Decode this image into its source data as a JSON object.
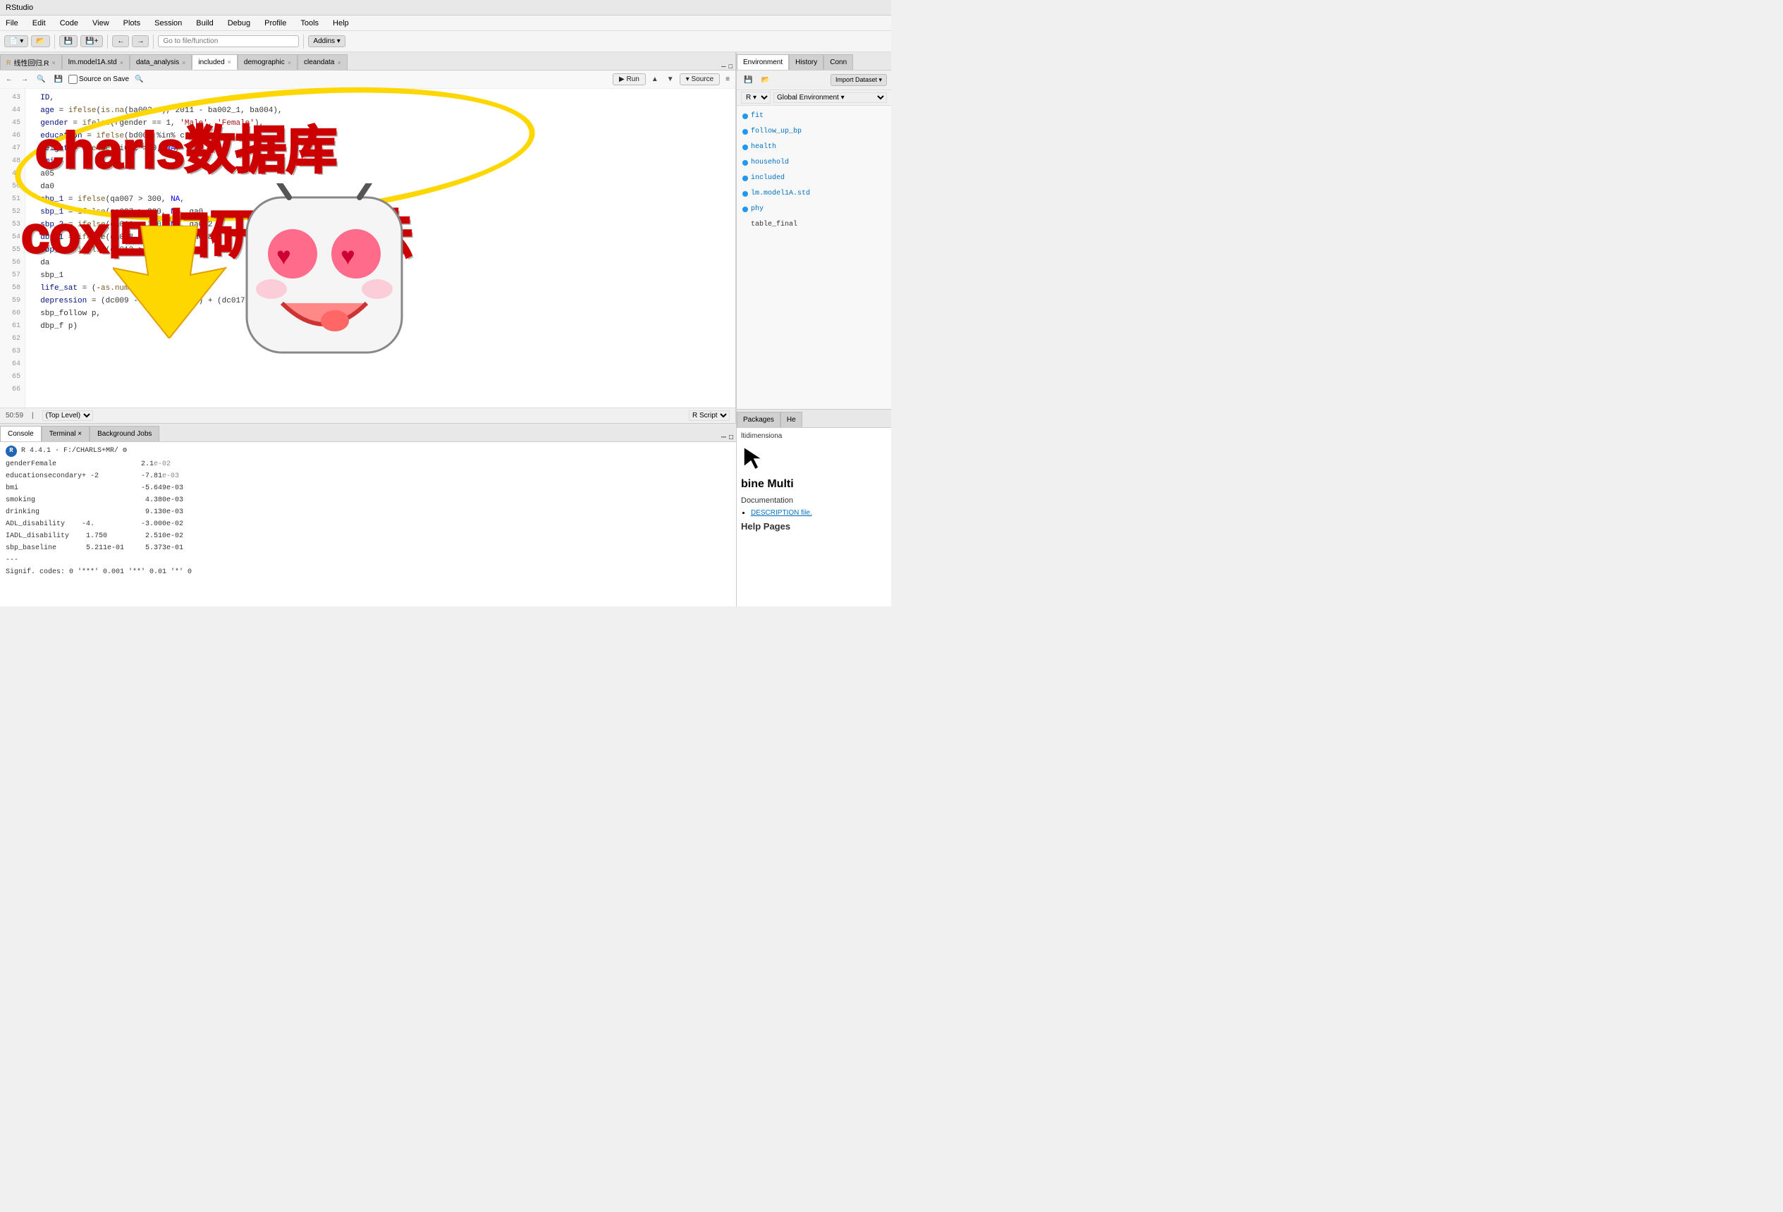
{
  "app": {
    "title": "RStudio",
    "menu_items": [
      "File",
      "Edit",
      "Code",
      "View",
      "Plots",
      "Session",
      "Build",
      "Debug",
      "Profile",
      "Tools",
      "Help"
    ]
  },
  "toolbar": {
    "goto_label": "Go to file/function",
    "addins_label": "Addins ▾"
  },
  "editor": {
    "tabs": [
      {
        "label": "线性回归.R",
        "active": false,
        "icon": "r-file"
      },
      {
        "label": "lm.model1A.std",
        "active": false,
        "icon": "data-file"
      },
      {
        "label": "data_analysis",
        "active": false,
        "icon": "data-file"
      },
      {
        "label": "included",
        "active": false,
        "icon": "data-file"
      },
      {
        "label": "demographic",
        "active": false,
        "icon": "data-file"
      },
      {
        "label": "cleandata",
        "active": false,
        "icon": "data-file"
      }
    ],
    "source_on_save": "Source on Save",
    "run_label": "▶ Run",
    "source_label": "▾ Source",
    "code_lines": [
      {
        "num": "43",
        "text": "  ID,"
      },
      {
        "num": "44",
        "text": "  age = ifelse(is.na(ba002_1), 2011 - ba002_1, ba004),"
      },
      {
        "num": "45",
        "text": "  gender = ifelse(rgender == 1, 'Male', 'Female'),"
      },
      {
        "num": "46",
        "text": "  education = ifelse(bd001 %in% c(2, 's', 'sec"
      },
      {
        "num": "47",
        "text": "  height = ifelse(qi002 > 0, NA,"
      },
      {
        "num": "48",
        "text": "  bmi"
      },
      {
        "num": "49",
        "text": "  a05"
      },
      {
        "num": "50",
        "text": "  da0"
      },
      {
        "num": "51",
        "text": "  sbp_1 = ifelse(qa007 > 300, NA,"
      },
      {
        "num": "52",
        "text": "  sbp_1 = ifelse(qa007 > 300, NA, qa0"
      },
      {
        "num": "53",
        "text": "  sbp_2 = ifelse(qa011 > 300, NA, qa012"
      },
      {
        "num": "54",
        "text": "  dbp_1 = ifelse(qa008 > 150, NA, qa008),"
      },
      {
        "num": "55",
        "text": "  dbp_2 = ifelse(qa012 > NA, qa012),"
      },
      {
        "num": "56",
        "text": ""
      },
      {
        "num": "57",
        "text": ""
      },
      {
        "num": "58",
        "text": "  da"
      },
      {
        "num": "59",
        "text": ""
      },
      {
        "num": "60",
        "text": ""
      },
      {
        "num": "61",
        "text": "  sbp_1"
      },
      {
        "num": "62",
        "text": "  life_sat = (-as.numeric(dc02 5,"
      },
      {
        "num": "63",
        "text": "  depression = (dc009 - 1) + (dc - 1) + (dc017 - ) + (dc01"
      },
      {
        "num": "64",
        "text": "  sbp_follow p,"
      },
      {
        "num": "65",
        "text": "  dbp_f p)"
      },
      {
        "num": "66",
        "text": ""
      }
    ],
    "status": {
      "position": "50:59",
      "context": "(Top Level)",
      "script_type": "R Script"
    }
  },
  "console": {
    "tabs": [
      {
        "label": "Console",
        "active": true
      },
      {
        "label": "Terminal",
        "active": false
      },
      {
        "label": "Background Jobs",
        "active": false
      }
    ],
    "r_version": "R 4.4.1",
    "path": "F:/CHARLS+MR/",
    "output_lines": [
      {
        "text": "genderFemale                    2.1"
      },
      {
        "text": "educationsecondary+ -2          -7.818e-03"
      },
      {
        "text": "bmi                             -5.649e-03"
      },
      {
        "text": "smoking                          4.380e-03"
      },
      {
        "text": "drinking                         9.130e-03"
      },
      {
        "text": "ADL_disability    -4.           -3.000e-02"
      },
      {
        "text": "IADL_disability    1.750         2.510e-02"
      },
      {
        "text": "sbp_baseline       5.211e-01     5.373e-01"
      },
      {
        "text": "---"
      },
      {
        "text": "Signif. codes: 0 '***' 0.001 '**' 0.01 '*' 0"
      }
    ]
  },
  "environment": {
    "tabs": [
      "Environment",
      "History",
      "Conn"
    ],
    "active_tab": "Environment",
    "history_label": "History",
    "toolbar": {
      "import_label": "Import Dataset ▾",
      "global_env": "Global Environment ▾"
    },
    "r_dropdown": "R ▾",
    "items": [
      {
        "name": "fit",
        "type": ""
      },
      {
        "name": "follow_up_bp",
        "type": ""
      },
      {
        "name": "health",
        "type": ""
      },
      {
        "name": "household",
        "type": ""
      },
      {
        "name": "included",
        "type": ""
      },
      {
        "name": "lm.model1A.std",
        "type": ""
      },
      {
        "name": "phy",
        "type": ""
      },
      {
        "name": "table_final",
        "type": ""
      }
    ]
  },
  "right_bottom": {
    "tabs": [
      "Packages",
      "He"
    ],
    "combine_text": "bine Multi",
    "documentation_title": "Documentation",
    "description_link": "DESCRIPTION file.",
    "help_pages": "Help Pages",
    "multidimensional_label": "ltidimensiona"
  },
  "overlay": {
    "title1": "charls数据库",
    "title2": "cox回归研究方法",
    "arrow_direction": "up-right"
  }
}
